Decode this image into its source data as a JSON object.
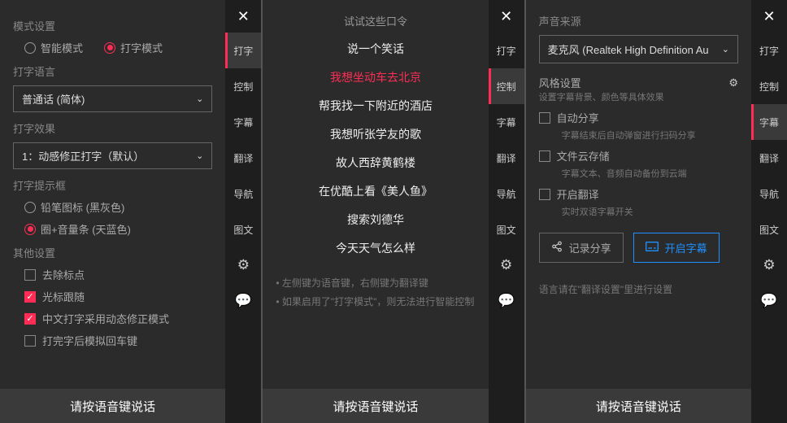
{
  "footer": "请按语音键说话",
  "sidebar": {
    "tabs": [
      "打字",
      "控制",
      "字幕",
      "翻译",
      "导航",
      "图文"
    ]
  },
  "panel1": {
    "mode_title": "模式设置",
    "mode_smart": "智能模式",
    "mode_type": "打字模式",
    "lang_title": "打字语言",
    "lang_value": "普通话 (简体)",
    "effect_title": "打字效果",
    "effect_value": "1：动感修正打字（默认）",
    "hint_title": "打字提示框",
    "hint_pencil": "铅笔图标 (黑灰色)",
    "hint_circle": "圈+音量条 (天蓝色)",
    "other_title": "其他设置",
    "cb1": "去除标点",
    "cb2": "光标跟随",
    "cb3": "中文打字采用动态修正模式",
    "cb4": "打完字后模拟回车键"
  },
  "panel2": {
    "title": "试试这些口令",
    "cmds": [
      "说一个笑话",
      "我想坐动车去北京",
      "帮我找一下附近的酒店",
      "我想听张学友的歌",
      "故人西辞黄鹤楼",
      "在优酷上看《美人鱼》",
      "搜索刘德华",
      "今天天气怎么样"
    ],
    "hint1": "左侧键为语音键，右侧键为翻译键",
    "hint2": "如果启用了\"打字模式\"，则无法进行智能控制"
  },
  "panel3": {
    "src_title": "声音来源",
    "src_value": "麦克风 (Realtek High Definition Au",
    "style_title": "风格设置",
    "style_sub": "设置字幕背景、颜色等具体效果",
    "auto_share": "自动分享",
    "auto_share_sub": "字幕结束后自动弹窗进行扫码分享",
    "cloud": "文件云存储",
    "cloud_sub": "字幕文本、音频自动备份到云端",
    "trans": "开启翻译",
    "trans_sub": "实时双语字幕开关",
    "btn_share": "记录分享",
    "btn_open": "开启字幕",
    "note": "语言请在\"翻译设置\"里进行设置"
  }
}
